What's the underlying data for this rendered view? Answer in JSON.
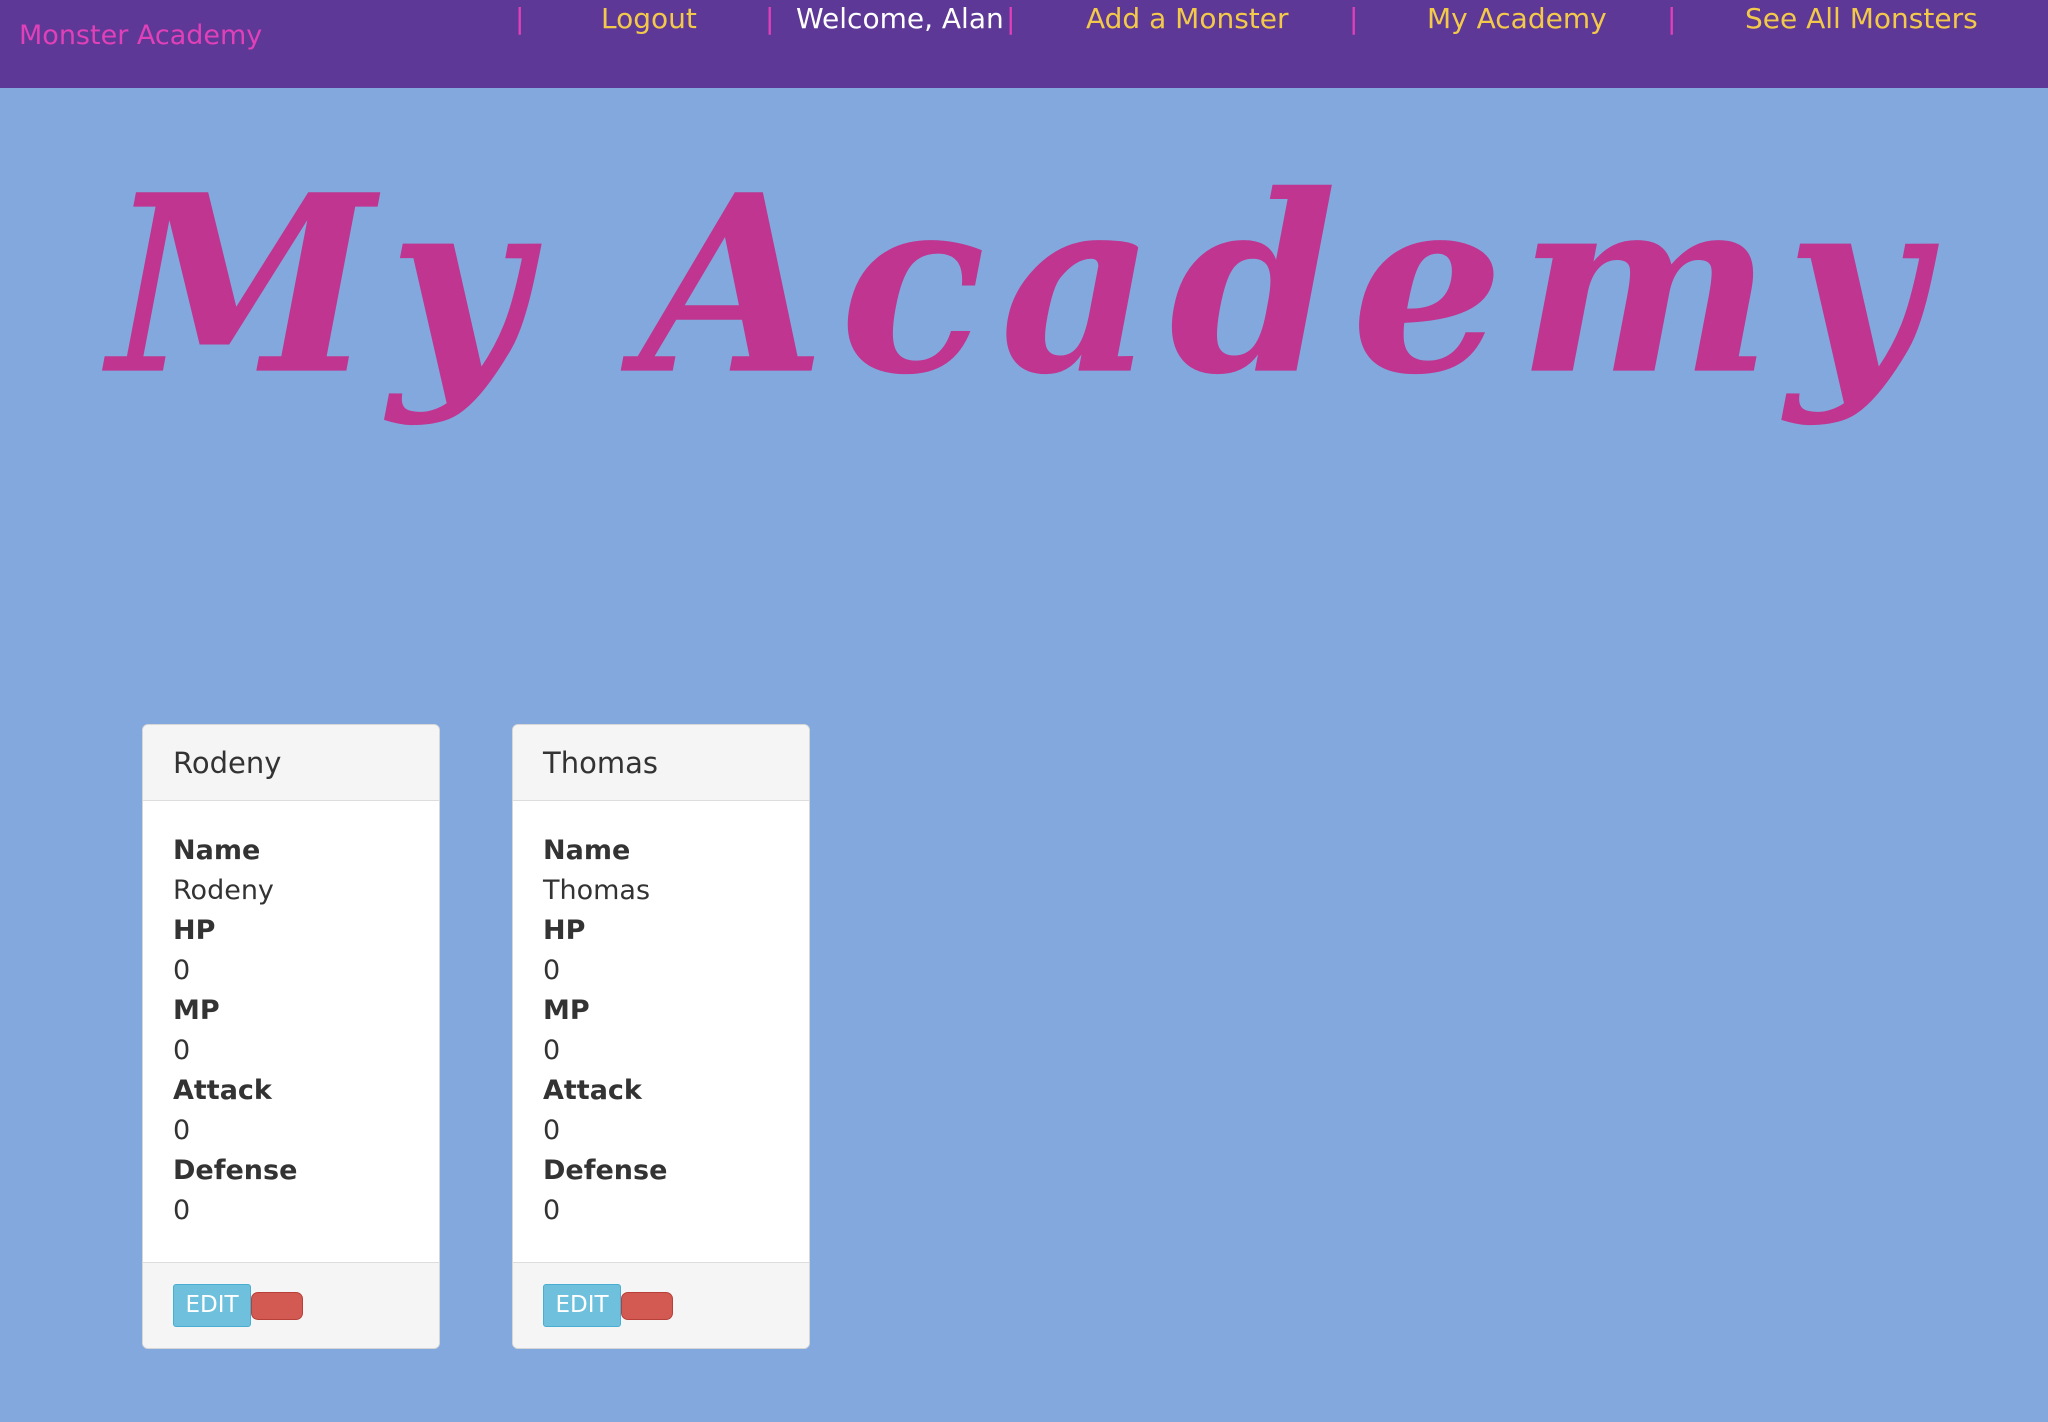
{
  "nav": {
    "brand": "Monster Academy",
    "separator": "|",
    "logout": "Logout",
    "welcome": "Welcome, Alan",
    "add_monster": "Add a Monster",
    "my_academy": "My Academy",
    "see_all": "See All Monsters"
  },
  "hero": {
    "title": "My Academy"
  },
  "colors": {
    "background": "#82a8dd",
    "navbar": "#5e3896",
    "brand": "#e040b8",
    "nav_link": "#f3c94a",
    "title": "#c0358f",
    "edit_button": "#6fc0dc",
    "delete_button": "#d35a52"
  },
  "monsters": [
    {
      "header": "Rodeny",
      "fields": [
        {
          "label": "Name",
          "value": "Rodeny"
        },
        {
          "label": "HP",
          "value": "0"
        },
        {
          "label": "MP",
          "value": "0"
        },
        {
          "label": "Attack",
          "value": "0"
        },
        {
          "label": "Defense",
          "value": "0"
        }
      ],
      "edit_label": "EDIT"
    },
    {
      "header": "Thomas",
      "fields": [
        {
          "label": "Name",
          "value": "Thomas"
        },
        {
          "label": "HP",
          "value": "0"
        },
        {
          "label": "MP",
          "value": "0"
        },
        {
          "label": "Attack",
          "value": "0"
        },
        {
          "label": "Defense",
          "value": "0"
        }
      ],
      "edit_label": "EDIT"
    }
  ]
}
